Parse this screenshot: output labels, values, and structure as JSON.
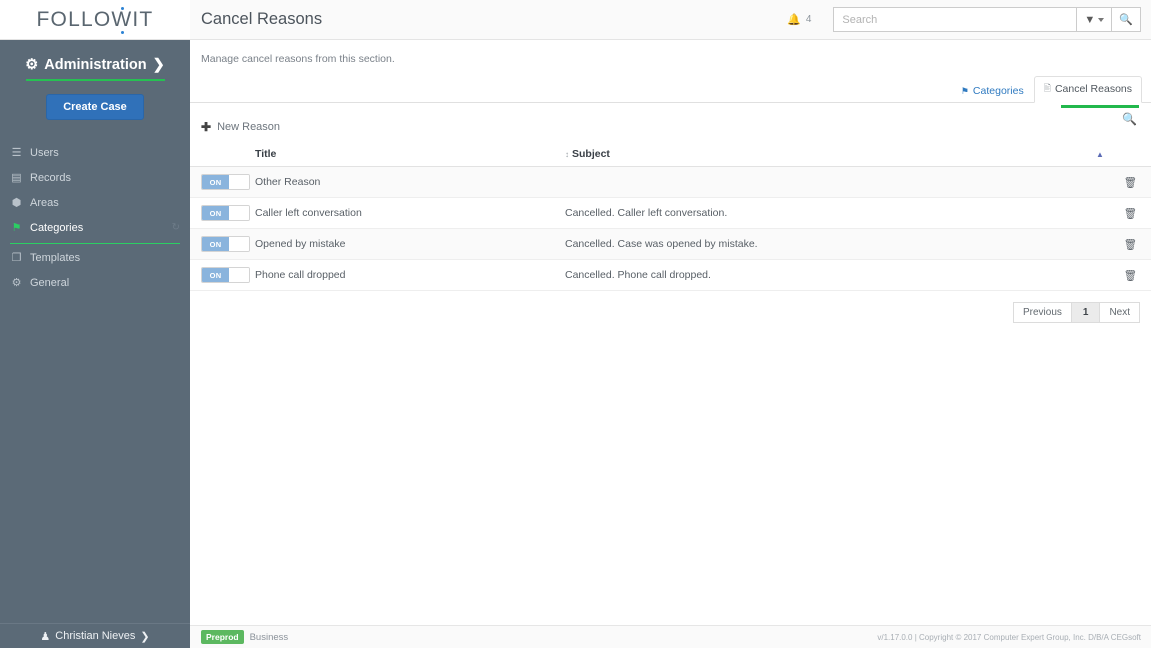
{
  "brand": {
    "logo_text": "FOLLOWIT",
    "accent_green": "#22b84c",
    "accent_blue": "#3071b9",
    "sidebar_bg": "#5b6a77"
  },
  "sidebar": {
    "section_title": "Administration",
    "section_chevron": "❯",
    "gear_icon": "⚙",
    "create_case_label": "Create Case",
    "items": [
      {
        "label": "Users",
        "icon": "user-icon",
        "glyph": "☰",
        "active": false
      },
      {
        "label": "Records",
        "icon": "records-icon",
        "glyph": "▤",
        "active": false
      },
      {
        "label": "Areas",
        "icon": "areas-icon",
        "glyph": "⬢",
        "active": false
      },
      {
        "label": "Categories",
        "icon": "tag-icon",
        "glyph": "⚑",
        "active": true,
        "aux_icon": "refresh-icon",
        "aux_glyph": "↻"
      },
      {
        "label": "Templates",
        "icon": "templates-icon",
        "glyph": "❐",
        "active": false
      },
      {
        "label": "General",
        "icon": "settings-icon",
        "glyph": "⚙",
        "active": false
      }
    ],
    "user": {
      "name": "Christian Nieves",
      "icon": "person-icon",
      "glyph": "♟",
      "chevron": "❯"
    }
  },
  "header": {
    "title": "Cancel Reasons",
    "notification": {
      "icon": "bell-icon",
      "glyph": "ὑ4",
      "count": "4"
    },
    "search": {
      "placeholder": "Search",
      "value": ""
    },
    "filter_button": {
      "icon": "filter-icon",
      "glyph": "▼"
    },
    "search_button": {
      "icon": "search-icon",
      "glyph": "⚲"
    }
  },
  "main": {
    "description": "Manage cancel reasons from this section.",
    "tabs": [
      {
        "label": "Categories",
        "icon": "tag-icon",
        "glyph": "⚑",
        "active": false
      },
      {
        "label": "Cancel Reasons",
        "icon": "document-icon",
        "glyph": "☰",
        "active": true
      }
    ],
    "panel_search_icon": {
      "icon": "search-icon",
      "glyph": "⚲"
    },
    "new_reason": {
      "label": "New Reason",
      "icon": "plus-icon",
      "glyph": "＋"
    }
  },
  "table": {
    "columns": {
      "toggle": "",
      "title": "Title",
      "subject": "Subject",
      "actions": ""
    },
    "sort_icons": {
      "title": "↕",
      "subject": "↕",
      "actions": "▲"
    },
    "toggle_on_label": "ON",
    "delete_icon": "trash-icon",
    "delete_glyph": "Ὕ1",
    "rows": [
      {
        "enabled": "ON",
        "title": "Other Reason",
        "subject": ""
      },
      {
        "enabled": "ON",
        "title": "Caller left conversation",
        "subject": "Cancelled. Caller left conversation."
      },
      {
        "enabled": "ON",
        "title": "Opened by mistake",
        "subject": "Cancelled. Case was opened by mistake."
      },
      {
        "enabled": "ON",
        "title": "Phone call dropped",
        "subject": "Cancelled. Phone call dropped."
      }
    ]
  },
  "pagination": {
    "previous_label": "Previous",
    "current_page": "1",
    "next_label": "Next"
  },
  "footer": {
    "environment_badge": "Preprod",
    "environment_name": "Business",
    "copyright": "v/1.17.0.0 | Copyright © 2017 Computer Expert Group, Inc. D/B/A CEGsoft"
  }
}
